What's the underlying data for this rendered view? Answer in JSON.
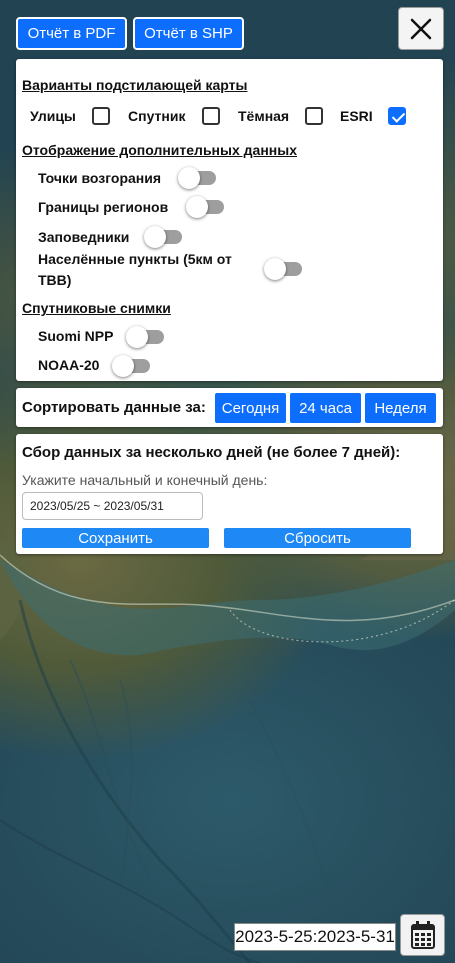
{
  "report_pdf_label": "Отчёт в PDF",
  "report_shp_label": "Отчёт в SHP",
  "basemap": {
    "title": "Варианты подстилающей карты",
    "options": [
      {
        "label": "Улицы",
        "checked": false
      },
      {
        "label": "Спутник",
        "checked": false
      },
      {
        "label": "Тёмная",
        "checked": false
      },
      {
        "label": "ESRI",
        "checked": true
      }
    ]
  },
  "extra_data": {
    "title": "Отображение дополнительных данных",
    "fire_points": "Точки возгорания",
    "region_borders": "Границы регионов",
    "reserves": "Заповедники",
    "settlements_line1": "Населённые пункты (5км от",
    "settlements_line2": "ТВВ)"
  },
  "satellite": {
    "title": "Спутниковые снимки",
    "suomi": "Suomi NPP",
    "noaa": "NOAA-20"
  },
  "sort": {
    "label": "Сортировать данные за:",
    "today": "Сегодня",
    "hours24": "24 часа",
    "week": "Неделя"
  },
  "multi_day": {
    "title": "Сбор данных за несколько дней (не более 7 дней):",
    "hint": "Укажите начальный и конечный день:",
    "range_value": "2023/05/25 ~ 2023/05/31",
    "save": "Сохранить",
    "reset": "Сбросить"
  },
  "footer_range": "2023-5-25:2023-5-31",
  "icons": {
    "close": "close-icon",
    "calendar": "calendar-icon"
  },
  "colors": {
    "accent": "#0d6efd",
    "action": "#1e88f5",
    "toggle_off": "#9e9e9e"
  }
}
